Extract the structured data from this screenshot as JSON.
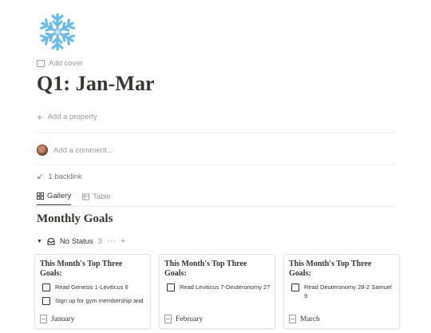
{
  "page": {
    "icon": "snowflake-icon",
    "add_cover": "Add cover",
    "title": "Q1: Jan-Mar",
    "add_property": "Add a property",
    "comment_placeholder": "Add a comment...",
    "backlink": "1 backlink"
  },
  "views": {
    "tabs": [
      {
        "label": "Gallery",
        "icon": "gallery-grid-icon",
        "active": true
      },
      {
        "label": "Table",
        "icon": "table-icon",
        "active": false
      }
    ]
  },
  "database": {
    "title": "Monthly Goals",
    "group": {
      "label": "No Status",
      "count": "3"
    },
    "cards": [
      {
        "heading": "This Month's Top Three Goals:",
        "tasks": [
          "Read Genesis 1-Leviticus 6",
          "Sign up for gym membership and"
        ],
        "name": "January"
      },
      {
        "heading": "This Month's Top Three Goals:",
        "tasks": [
          "Read Leviticus 7-Deuteronomy 27"
        ],
        "name": "February"
      },
      {
        "heading": "This Month's Top Three Goals:",
        "tasks": [
          "Read Deuteronomy 28-2 Samuel 9"
        ],
        "name": "March"
      }
    ]
  },
  "colors": {
    "text": "#37352f",
    "muted": "#9b9a97",
    "divider": "#ededec",
    "snowflake": "#7fc6ea"
  }
}
